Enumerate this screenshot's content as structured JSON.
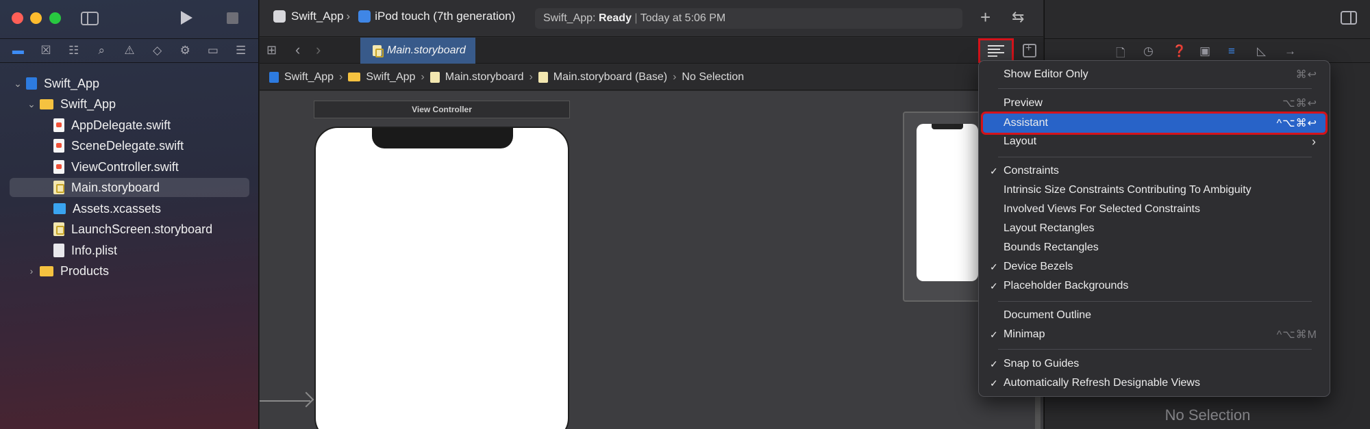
{
  "sidebar": {
    "tree": [
      {
        "label": "Swift_App",
        "icon": "xcode-project-icon",
        "expanded": true
      },
      {
        "label": "Swift_App",
        "icon": "folder-icon",
        "expanded": true
      },
      {
        "label": "AppDelegate.swift",
        "icon": "swift-file-icon"
      },
      {
        "label": "SceneDelegate.swift",
        "icon": "swift-file-icon"
      },
      {
        "label": "ViewController.swift",
        "icon": "swift-file-icon"
      },
      {
        "label": "Main.storyboard",
        "icon": "storyboard-file-icon",
        "selected": true
      },
      {
        "label": "Assets.xcassets",
        "icon": "asset-catalog-icon"
      },
      {
        "label": "LaunchScreen.storyboard",
        "icon": "storyboard-file-icon"
      },
      {
        "label": "Info.plist",
        "icon": "plist-file-icon"
      },
      {
        "label": "Products",
        "icon": "folder-icon",
        "expanded": false
      }
    ]
  },
  "toolbar": {
    "scheme": "Swift_App",
    "destination": "iPod touch (7th generation)",
    "activity_app": "Swift_App:",
    "activity_status": "Ready",
    "activity_time": "Today at 5:06 PM"
  },
  "tabbar": {
    "active_tab": "Main.storyboard"
  },
  "jumpbar": {
    "crumbs": [
      "Swift_App",
      "Swift_App",
      "Main.storyboard",
      "Main.storyboard (Base)",
      "No Selection"
    ]
  },
  "canvas": {
    "scene_title": "View Controller"
  },
  "inspector": {
    "no_selection": "No Selection"
  },
  "menu": {
    "items": [
      {
        "label": "Show Editor Only",
        "shortcut": "⌘↩",
        "checked": false
      },
      {
        "label": "Preview",
        "shortcut": "⌥⌘↩",
        "checked": false
      },
      {
        "label": "Assistant",
        "shortcut": "^⌥⌘↩",
        "checked": false,
        "highlighted": true
      },
      {
        "label": "Layout",
        "shortcut": "",
        "checked": false,
        "submenu": true
      },
      {
        "label": "Constraints",
        "shortcut": "",
        "checked": true
      },
      {
        "label": "Intrinsic Size Constraints Contributing To Ambiguity",
        "shortcut": "",
        "checked": false
      },
      {
        "label": "Involved Views For Selected Constraints",
        "shortcut": "",
        "checked": false
      },
      {
        "label": "Layout Rectangles",
        "shortcut": "",
        "checked": false
      },
      {
        "label": "Bounds Rectangles",
        "shortcut": "",
        "checked": false
      },
      {
        "label": "Device Bezels",
        "shortcut": "",
        "checked": true
      },
      {
        "label": "Placeholder Backgrounds",
        "shortcut": "",
        "checked": true
      },
      {
        "label": "Document Outline",
        "shortcut": "",
        "checked": false
      },
      {
        "label": "Minimap",
        "shortcut": "^⌥⌘M",
        "checked": true
      },
      {
        "label": "Snap to Guides",
        "shortcut": "",
        "checked": true
      },
      {
        "label": "Automatically Refresh Designable Views",
        "shortcut": "",
        "checked": true
      }
    ],
    "check_glyph": "✓",
    "submenu_glyph": "›"
  },
  "colors": {
    "accent": "#2863c8",
    "highlight_box": "#d4131b"
  }
}
